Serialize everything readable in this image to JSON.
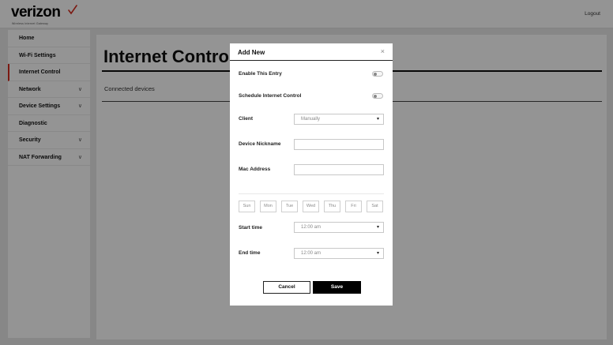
{
  "header": {
    "logo_text": "verizon",
    "logo_tagline": "Wireless Internet Gateway",
    "logout_label": "Logout",
    "brand_accent": "#d52b1e"
  },
  "sidebar": {
    "items": [
      {
        "label": "Home",
        "has_chevron": false
      },
      {
        "label": "Wi-Fi Settings",
        "has_chevron": false
      },
      {
        "label": "Internet Control",
        "has_chevron": false,
        "active": true
      },
      {
        "label": "Network",
        "has_chevron": true
      },
      {
        "label": "Device Settings",
        "has_chevron": true
      },
      {
        "label": "Diagnostic",
        "has_chevron": false
      },
      {
        "label": "Security",
        "has_chevron": true
      },
      {
        "label": "NAT Forwarding",
        "has_chevron": true
      }
    ]
  },
  "main": {
    "title": "Internet Control",
    "connected_devices_label": "Connected devices"
  },
  "modal": {
    "title": "Add New",
    "close_glyph": "×",
    "enable_entry_label": "Enable This Entry",
    "enable_entry_on": false,
    "schedule_label": "Schedule Internet Control",
    "schedule_on": false,
    "client_label": "Client",
    "client_value": "Manually",
    "nickname_label": "Device Nickname",
    "nickname_value": "",
    "mac_label": "Mac Address",
    "mac_value": "",
    "days": [
      "Sun",
      "Mon",
      "Tue",
      "Wed",
      "Thu",
      "Fri",
      "Sat"
    ],
    "start_label": "Start time",
    "start_value": "12:00 am",
    "end_label": "End time",
    "end_value": "12:00 am",
    "cancel_label": "Cancel",
    "save_label": "Save"
  }
}
